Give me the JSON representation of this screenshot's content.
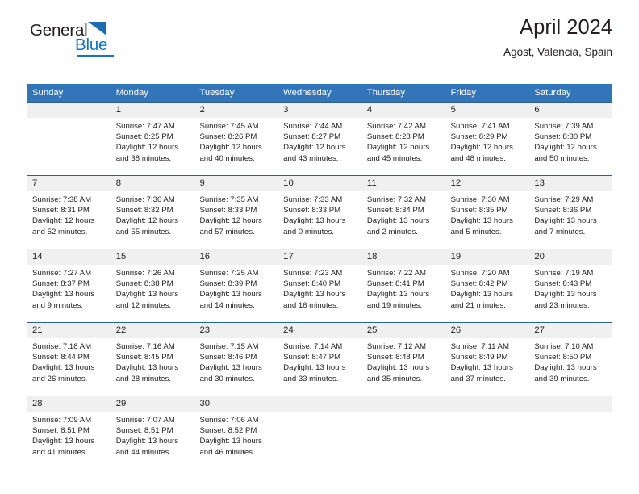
{
  "brand": {
    "name_top": "General",
    "name_bottom": "Blue",
    "triangle_icon": "triangle-icon",
    "color_top": "#231f20",
    "color_bottom": "#1b72bb"
  },
  "header": {
    "title": "April 2024",
    "subtitle": "Agost, Valencia, Spain"
  },
  "theme": {
    "header_blue": "#3275b8",
    "week_divider": "#2b5f93",
    "day_band": "#f0f0f0",
    "text": "#231f20"
  },
  "weekdays": [
    "Sunday",
    "Monday",
    "Tuesday",
    "Wednesday",
    "Thursday",
    "Friday",
    "Saturday"
  ],
  "weeks": [
    [
      {
        "day": "",
        "sunrise": "",
        "sunset": "",
        "daylight_1": "",
        "daylight_2": ""
      },
      {
        "day": "1",
        "sunrise": "Sunrise: 7:47 AM",
        "sunset": "Sunset: 8:25 PM",
        "daylight_1": "Daylight: 12 hours",
        "daylight_2": "and 38 minutes."
      },
      {
        "day": "2",
        "sunrise": "Sunrise: 7:45 AM",
        "sunset": "Sunset: 8:26 PM",
        "daylight_1": "Daylight: 12 hours",
        "daylight_2": "and 40 minutes."
      },
      {
        "day": "3",
        "sunrise": "Sunrise: 7:44 AM",
        "sunset": "Sunset: 8:27 PM",
        "daylight_1": "Daylight: 12 hours",
        "daylight_2": "and 43 minutes."
      },
      {
        "day": "4",
        "sunrise": "Sunrise: 7:42 AM",
        "sunset": "Sunset: 8:28 PM",
        "daylight_1": "Daylight: 12 hours",
        "daylight_2": "and 45 minutes."
      },
      {
        "day": "5",
        "sunrise": "Sunrise: 7:41 AM",
        "sunset": "Sunset: 8:29 PM",
        "daylight_1": "Daylight: 12 hours",
        "daylight_2": "and 48 minutes."
      },
      {
        "day": "6",
        "sunrise": "Sunrise: 7:39 AM",
        "sunset": "Sunset: 8:30 PM",
        "daylight_1": "Daylight: 12 hours",
        "daylight_2": "and 50 minutes."
      }
    ],
    [
      {
        "day": "7",
        "sunrise": "Sunrise: 7:38 AM",
        "sunset": "Sunset: 8:31 PM",
        "daylight_1": "Daylight: 12 hours",
        "daylight_2": "and 52 minutes."
      },
      {
        "day": "8",
        "sunrise": "Sunrise: 7:36 AM",
        "sunset": "Sunset: 8:32 PM",
        "daylight_1": "Daylight: 12 hours",
        "daylight_2": "and 55 minutes."
      },
      {
        "day": "9",
        "sunrise": "Sunrise: 7:35 AM",
        "sunset": "Sunset: 8:33 PM",
        "daylight_1": "Daylight: 12 hours",
        "daylight_2": "and 57 minutes."
      },
      {
        "day": "10",
        "sunrise": "Sunrise: 7:33 AM",
        "sunset": "Sunset: 8:33 PM",
        "daylight_1": "Daylight: 13 hours",
        "daylight_2": "and 0 minutes."
      },
      {
        "day": "11",
        "sunrise": "Sunrise: 7:32 AM",
        "sunset": "Sunset: 8:34 PM",
        "daylight_1": "Daylight: 13 hours",
        "daylight_2": "and 2 minutes."
      },
      {
        "day": "12",
        "sunrise": "Sunrise: 7:30 AM",
        "sunset": "Sunset: 8:35 PM",
        "daylight_1": "Daylight: 13 hours",
        "daylight_2": "and 5 minutes."
      },
      {
        "day": "13",
        "sunrise": "Sunrise: 7:29 AM",
        "sunset": "Sunset: 8:36 PM",
        "daylight_1": "Daylight: 13 hours",
        "daylight_2": "and 7 minutes."
      }
    ],
    [
      {
        "day": "14",
        "sunrise": "Sunrise: 7:27 AM",
        "sunset": "Sunset: 8:37 PM",
        "daylight_1": "Daylight: 13 hours",
        "daylight_2": "and 9 minutes."
      },
      {
        "day": "15",
        "sunrise": "Sunrise: 7:26 AM",
        "sunset": "Sunset: 8:38 PM",
        "daylight_1": "Daylight: 13 hours",
        "daylight_2": "and 12 minutes."
      },
      {
        "day": "16",
        "sunrise": "Sunrise: 7:25 AM",
        "sunset": "Sunset: 8:39 PM",
        "daylight_1": "Daylight: 13 hours",
        "daylight_2": "and 14 minutes."
      },
      {
        "day": "17",
        "sunrise": "Sunrise: 7:23 AM",
        "sunset": "Sunset: 8:40 PM",
        "daylight_1": "Daylight: 13 hours",
        "daylight_2": "and 16 minutes."
      },
      {
        "day": "18",
        "sunrise": "Sunrise: 7:22 AM",
        "sunset": "Sunset: 8:41 PM",
        "daylight_1": "Daylight: 13 hours",
        "daylight_2": "and 19 minutes."
      },
      {
        "day": "19",
        "sunrise": "Sunrise: 7:20 AM",
        "sunset": "Sunset: 8:42 PM",
        "daylight_1": "Daylight: 13 hours",
        "daylight_2": "and 21 minutes."
      },
      {
        "day": "20",
        "sunrise": "Sunrise: 7:19 AM",
        "sunset": "Sunset: 8:43 PM",
        "daylight_1": "Daylight: 13 hours",
        "daylight_2": "and 23 minutes."
      }
    ],
    [
      {
        "day": "21",
        "sunrise": "Sunrise: 7:18 AM",
        "sunset": "Sunset: 8:44 PM",
        "daylight_1": "Daylight: 13 hours",
        "daylight_2": "and 26 minutes."
      },
      {
        "day": "22",
        "sunrise": "Sunrise: 7:16 AM",
        "sunset": "Sunset: 8:45 PM",
        "daylight_1": "Daylight: 13 hours",
        "daylight_2": "and 28 minutes."
      },
      {
        "day": "23",
        "sunrise": "Sunrise: 7:15 AM",
        "sunset": "Sunset: 8:46 PM",
        "daylight_1": "Daylight: 13 hours",
        "daylight_2": "and 30 minutes."
      },
      {
        "day": "24",
        "sunrise": "Sunrise: 7:14 AM",
        "sunset": "Sunset: 8:47 PM",
        "daylight_1": "Daylight: 13 hours",
        "daylight_2": "and 33 minutes."
      },
      {
        "day": "25",
        "sunrise": "Sunrise: 7:12 AM",
        "sunset": "Sunset: 8:48 PM",
        "daylight_1": "Daylight: 13 hours",
        "daylight_2": "and 35 minutes."
      },
      {
        "day": "26",
        "sunrise": "Sunrise: 7:11 AM",
        "sunset": "Sunset: 8:49 PM",
        "daylight_1": "Daylight: 13 hours",
        "daylight_2": "and 37 minutes."
      },
      {
        "day": "27",
        "sunrise": "Sunrise: 7:10 AM",
        "sunset": "Sunset: 8:50 PM",
        "daylight_1": "Daylight: 13 hours",
        "daylight_2": "and 39 minutes."
      }
    ],
    [
      {
        "day": "28",
        "sunrise": "Sunrise: 7:09 AM",
        "sunset": "Sunset: 8:51 PM",
        "daylight_1": "Daylight: 13 hours",
        "daylight_2": "and 41 minutes."
      },
      {
        "day": "29",
        "sunrise": "Sunrise: 7:07 AM",
        "sunset": "Sunset: 8:51 PM",
        "daylight_1": "Daylight: 13 hours",
        "daylight_2": "and 44 minutes."
      },
      {
        "day": "30",
        "sunrise": "Sunrise: 7:06 AM",
        "sunset": "Sunset: 8:52 PM",
        "daylight_1": "Daylight: 13 hours",
        "daylight_2": "and 46 minutes."
      },
      {
        "day": "",
        "sunrise": "",
        "sunset": "",
        "daylight_1": "",
        "daylight_2": ""
      },
      {
        "day": "",
        "sunrise": "",
        "sunset": "",
        "daylight_1": "",
        "daylight_2": ""
      },
      {
        "day": "",
        "sunrise": "",
        "sunset": "",
        "daylight_1": "",
        "daylight_2": ""
      },
      {
        "day": "",
        "sunrise": "",
        "sunset": "",
        "daylight_1": "",
        "daylight_2": ""
      }
    ]
  ]
}
